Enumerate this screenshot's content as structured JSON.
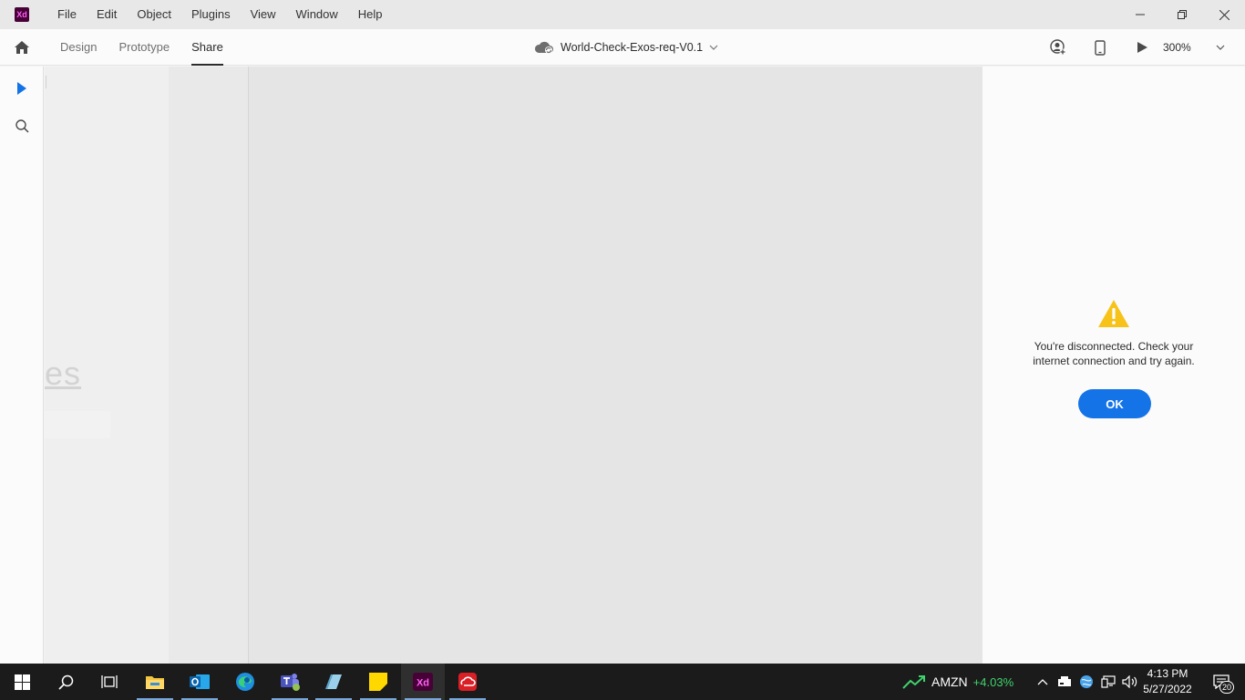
{
  "app": {
    "logo_text": "Xd",
    "menu": [
      "File",
      "Edit",
      "Object",
      "Plugins",
      "View",
      "Window",
      "Help"
    ]
  },
  "toolbar": {
    "tabs": [
      "Design",
      "Prototype",
      "Share"
    ],
    "active_tab": "Share",
    "document_title": "World-Check-Exos-req-V0.1",
    "zoom": "300%"
  },
  "canvas": {
    "faded_text": "es"
  },
  "right_panel": {
    "warning_line1": "You're disconnected. Check your",
    "warning_line2": "internet connection and try again.",
    "ok_label": "OK"
  },
  "taskbar": {
    "apps": [
      "start-icon",
      "search-icon",
      "task-view-icon",
      "file-explorer-icon",
      "outlook-icon",
      "edge-icon",
      "teams-icon",
      "notepad-icon",
      "sticky-notes-icon",
      "adobe-xd-icon",
      "creative-cloud-icon"
    ],
    "stock_symbol": "AMZN",
    "stock_change": "+4.03%",
    "time": "4:13 PM",
    "date": "5/27/2022",
    "notification_count": "20"
  },
  "colors": {
    "accent_blue": "#1473e6",
    "warning_yellow": "#f7c31a",
    "stock_green": "#3ed46b",
    "xd_brand": "#470137"
  }
}
